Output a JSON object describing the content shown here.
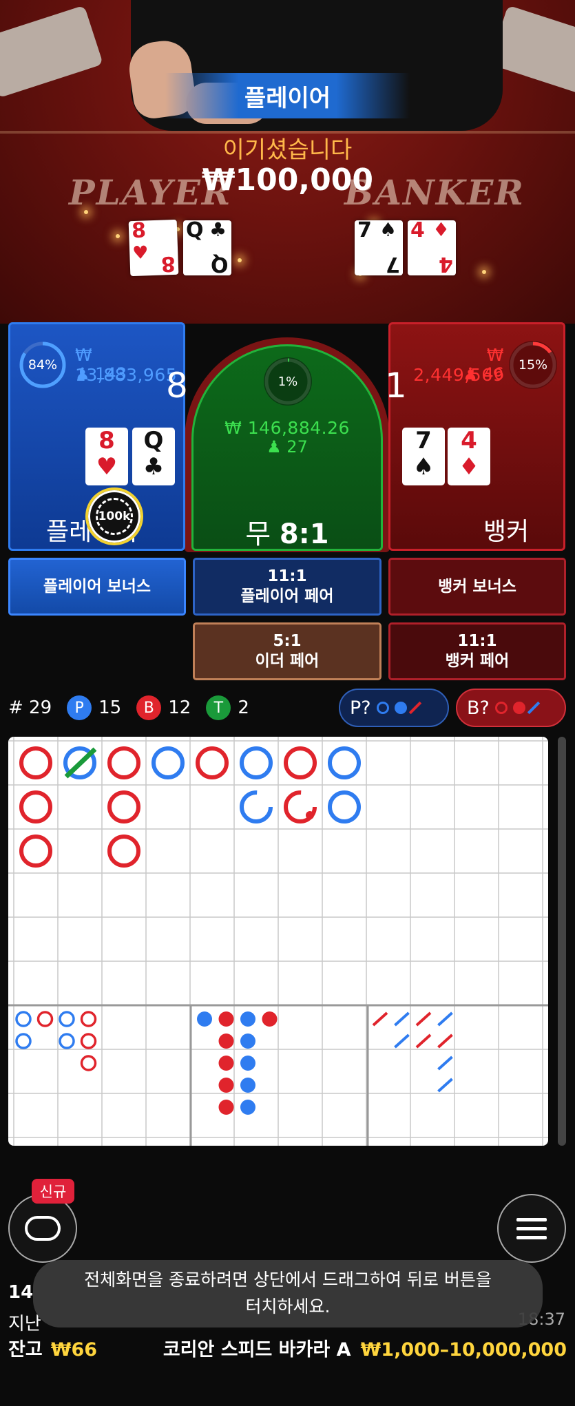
{
  "video": {
    "winner_banner": "플레이어",
    "win_message": "이기셨습니다",
    "win_amount": "₩100,000",
    "table_word_player": "PLAYER",
    "table_word_banker": "BANKER",
    "player_cards": [
      {
        "rank": "8",
        "suit": "♥",
        "color": "red"
      },
      {
        "rank": "Q",
        "suit": "♣",
        "color": "black"
      }
    ],
    "banker_cards": [
      {
        "rank": "7",
        "suit": "♠",
        "color": "black"
      },
      {
        "rank": "4",
        "suit": "♦",
        "color": "red"
      }
    ]
  },
  "player_panel": {
    "percent": "84%",
    "percent_value": 0.84,
    "total_bet": "₩ 13,883,965",
    "bettors": "143",
    "score": "8",
    "label": "플레이어",
    "cards": [
      {
        "rank": "8",
        "suit": "♥",
        "color": "red"
      },
      {
        "rank": "Q",
        "suit": "♣",
        "color": "black"
      }
    ]
  },
  "tie_panel": {
    "percent": "1%",
    "percent_value": 0.01,
    "total_bet": "₩ 146,884.26",
    "bettors": "27",
    "label": "무",
    "payout": "8:1"
  },
  "banker_panel": {
    "percent": "15%",
    "percent_value": 0.15,
    "total_bet": "₩ 2,449,569",
    "bettors": "46",
    "score": "1",
    "label": "뱅커",
    "cards": [
      {
        "rank": "7",
        "suit": "♠",
        "color": "black"
      },
      {
        "rank": "4",
        "suit": "♦",
        "color": "red"
      }
    ]
  },
  "chip": {
    "label": "100k"
  },
  "side_bets": {
    "player_bonus": {
      "label": "플레이어 보너스"
    },
    "player_pair": {
      "odds": "11:1",
      "label": "플레이어 페어"
    },
    "banker_bonus": {
      "label": "뱅커 보너스"
    },
    "either_pair": {
      "odds": "5:1",
      "label": "이더 페어"
    },
    "banker_pair": {
      "odds": "11:1",
      "label": "뱅커 페어"
    }
  },
  "stats": {
    "rounds": "# 29",
    "player_badge": "P",
    "player_count": "15",
    "banker_badge": "B",
    "banker_count": "12",
    "tie_badge": "T",
    "tie_count": "2",
    "ask_player": "P?",
    "ask_banker": "B?"
  },
  "colors": {
    "player": "#2f7cf0",
    "banker": "#e0242c",
    "tie": "#1a9a3a",
    "gold": "#ffd53d"
  },
  "roadmap": {
    "bead_plate": [
      {
        "col": 0,
        "row": 0,
        "s": "B"
      },
      {
        "col": 0,
        "row": 1,
        "s": "B"
      },
      {
        "col": 0,
        "row": 2,
        "s": "B"
      },
      {
        "col": 1,
        "row": 0,
        "s": "P",
        "tie": true
      },
      {
        "col": 2,
        "row": 0,
        "s": "B"
      },
      {
        "col": 2,
        "row": 1,
        "s": "B"
      },
      {
        "col": 2,
        "row": 2,
        "s": "B"
      },
      {
        "col": 3,
        "row": 0,
        "s": "P"
      },
      {
        "col": 4,
        "row": 0,
        "s": "B"
      },
      {
        "col": 5,
        "row": 0,
        "s": "P"
      },
      {
        "col": 5,
        "row": 1,
        "s": "P",
        "partial": true
      },
      {
        "col": 6,
        "row": 0,
        "s": "B"
      },
      {
        "col": 6,
        "row": 1,
        "s": "B",
        "partial": true,
        "dot": true
      },
      {
        "col": 7,
        "row": 0,
        "s": "P"
      },
      {
        "col": 7,
        "row": 1,
        "s": "P"
      }
    ],
    "big_eye": [
      {
        "c": 0,
        "r": 0,
        "s": "P"
      },
      {
        "c": 0,
        "r": 1,
        "s": "P"
      },
      {
        "c": 1,
        "r": 0,
        "s": "B"
      },
      {
        "c": 2,
        "r": 0,
        "s": "P"
      },
      {
        "c": 2,
        "r": 1,
        "s": "P"
      },
      {
        "c": 3,
        "r": 0,
        "s": "B"
      },
      {
        "c": 3,
        "r": 1,
        "s": "B"
      },
      {
        "c": 3,
        "r": 2,
        "s": "B"
      }
    ],
    "small": [
      {
        "c": 0,
        "r": 0,
        "s": "P"
      },
      {
        "c": 1,
        "r": 0,
        "s": "B"
      },
      {
        "c": 1,
        "r": 1,
        "s": "B"
      },
      {
        "c": 1,
        "r": 2,
        "s": "B"
      },
      {
        "c": 1,
        "r": 3,
        "s": "B"
      },
      {
        "c": 1,
        "r": 4,
        "s": "B"
      },
      {
        "c": 2,
        "r": 0,
        "s": "P"
      },
      {
        "c": 2,
        "r": 1,
        "s": "P"
      },
      {
        "c": 2,
        "r": 2,
        "s": "P"
      },
      {
        "c": 2,
        "r": 3,
        "s": "P"
      },
      {
        "c": 2,
        "r": 4,
        "s": "P"
      },
      {
        "c": 3,
        "r": 0,
        "s": "B"
      }
    ],
    "cockroach": [
      {
        "c": 0,
        "r": 0,
        "s": "B"
      },
      {
        "c": 1,
        "r": 0,
        "s": "P"
      },
      {
        "c": 1,
        "r": 1,
        "s": "P"
      },
      {
        "c": 2,
        "r": 0,
        "s": "B"
      },
      {
        "c": 2,
        "r": 1,
        "s": "B"
      },
      {
        "c": 3,
        "r": 0,
        "s": "P"
      },
      {
        "c": 3,
        "r": 1,
        "s": "B"
      },
      {
        "c": 3,
        "r": 2,
        "s": "P"
      },
      {
        "c": 3,
        "r": 3,
        "s": "P"
      }
    ]
  },
  "bottom": {
    "new_badge": "신규",
    "info_line1": "14",
    "info_line2": "지난",
    "info_time": "18:37",
    "balance_label": "잔고",
    "balance": "₩66",
    "table_name": "코리안 스피드 바카라 A",
    "limits": "₩1,000–10,000,000",
    "toast_line1": "전체화면을 종료하려면 상단에서 드래그하여 뒤로 버튼을",
    "toast_line2": "터치하세요."
  },
  "icons": [
    "chat-icon",
    "menu-icon",
    "player-bettors-icon",
    "banker-bettors-icon",
    "tie-bettors-icon",
    "chip-icon"
  ]
}
